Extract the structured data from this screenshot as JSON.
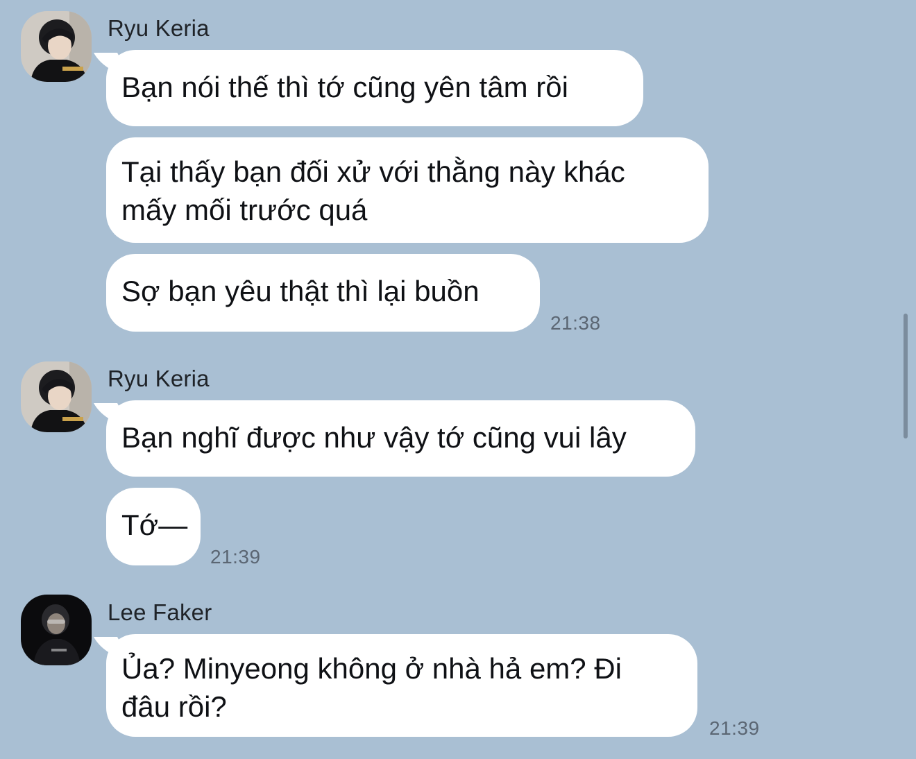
{
  "colors": {
    "background": "#a9bfd3",
    "bubble": "#ffffff",
    "text": "#0f1115",
    "timestamp": "#5b6673"
  },
  "groups": [
    {
      "sender": "Ryu Keria",
      "avatar_icon": "user-avatar-keria-icon",
      "messages": [
        {
          "lines": [
            "Bạn nói thế thì tớ cũng yên tâm rồi"
          ]
        },
        {
          "lines": [
            "Tại thấy bạn đối xử với thằng này khác",
            "mấy mối trước quá"
          ]
        },
        {
          "lines": [
            "Sợ bạn yêu thật thì lại buồn"
          ]
        }
      ],
      "time": "21:38"
    },
    {
      "sender": "Ryu Keria",
      "avatar_icon": "user-avatar-keria-icon",
      "messages": [
        {
          "lines": [
            "Bạn nghĩ được như vậy tớ cũng vui lây"
          ]
        },
        {
          "lines": [
            "Tớ—"
          ]
        }
      ],
      "time": "21:39"
    },
    {
      "sender": "Lee Faker",
      "avatar_icon": "user-avatar-faker-icon",
      "messages": [
        {
          "lines": [
            "Ủa? Minyeong không ở nhà hả em? Đi",
            "đâu rồi?"
          ]
        }
      ],
      "time": "21:39"
    }
  ]
}
